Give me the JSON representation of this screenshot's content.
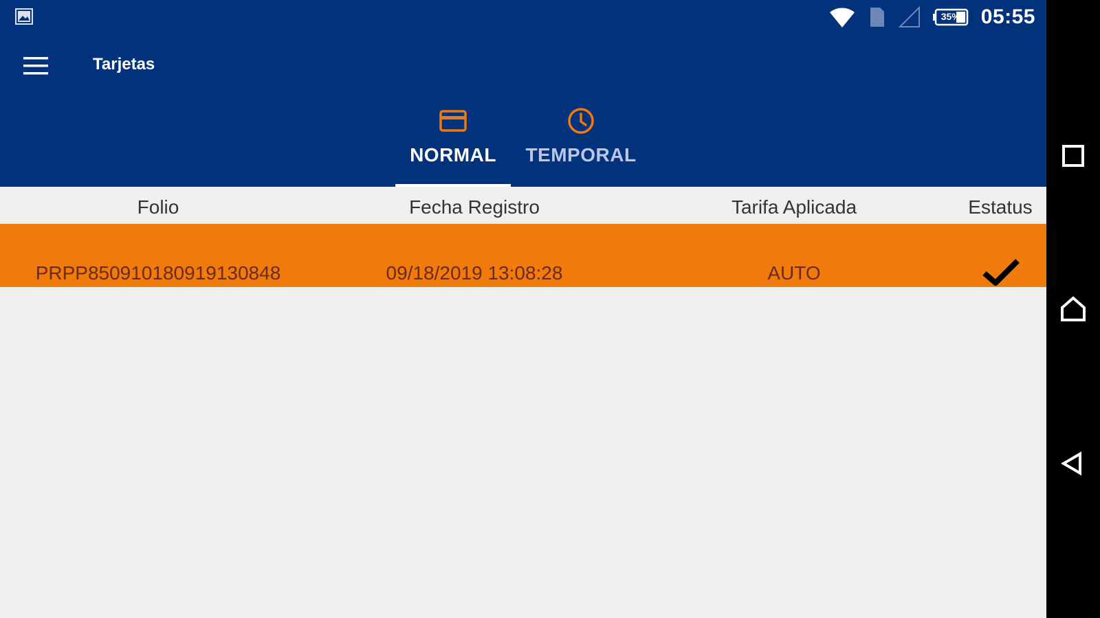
{
  "status_bar": {
    "time": "05:55",
    "battery": "35%",
    "icons": [
      "image-icon",
      "wifi-icon",
      "sim-icon",
      "signal-icon",
      "battery-icon"
    ]
  },
  "toolbar": {
    "title": "Tarjetas",
    "menu_icon": "hamburger-menu-icon"
  },
  "tabs": [
    {
      "label": "NORMAL",
      "icon": "credit-card-icon",
      "selected": true
    },
    {
      "label": "TEMPORAL",
      "icon": "clock-icon",
      "selected": false
    }
  ],
  "table": {
    "columns": [
      "Folio",
      "Fecha Registro",
      "Tarifa Aplicada",
      "Estatus"
    ],
    "rows": [
      {
        "folio": "PRPP850910180919130848",
        "fecha": "09/18/2019 13:08:28",
        "tarifa": "AUTO",
        "estatus": "check-icon"
      }
    ]
  },
  "colors": {
    "primary": "#03327c",
    "accent": "#f07a0a",
    "background": "#efefef",
    "row_text": "#6a2a1c"
  },
  "nav_bar": [
    "recents-icon",
    "home-icon",
    "back-icon"
  ]
}
